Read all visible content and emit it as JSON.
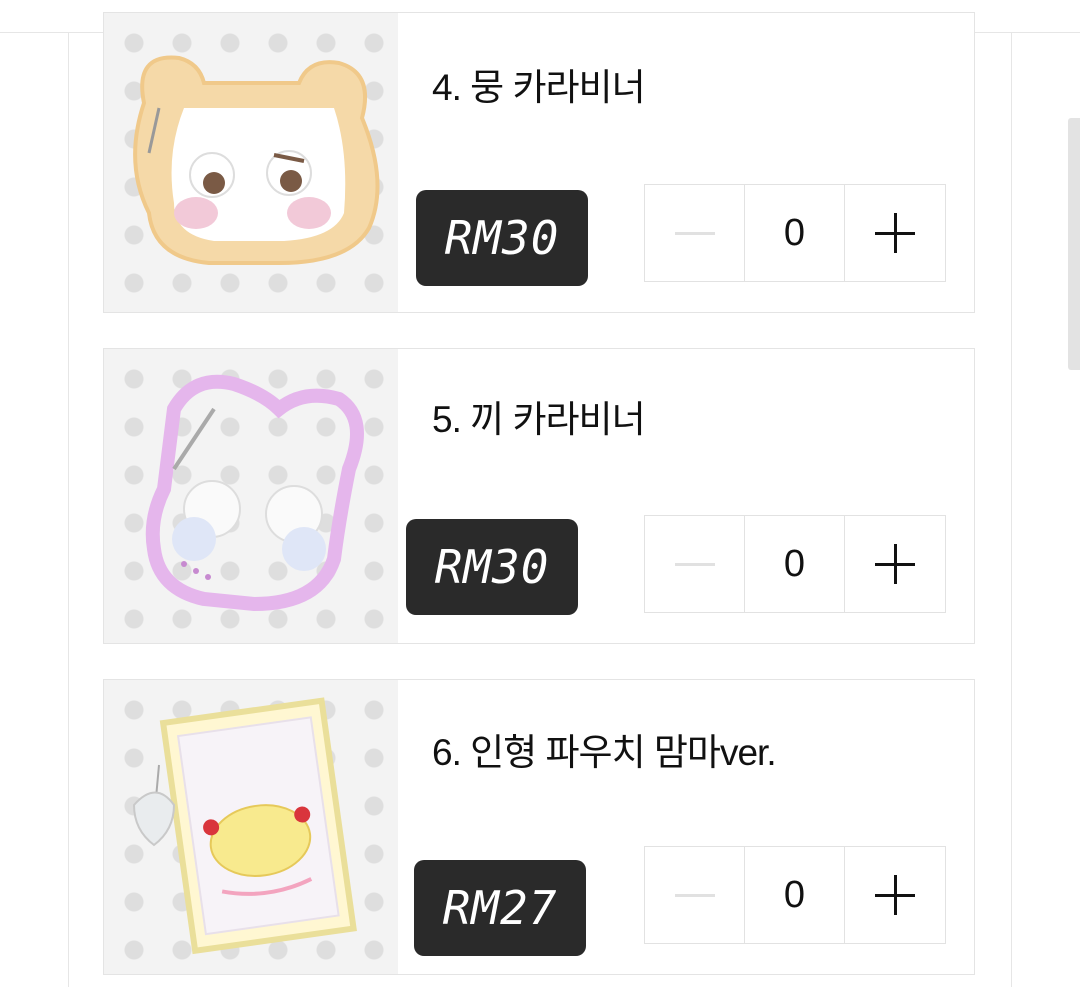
{
  "products": [
    {
      "title": "4. 뭉 카라비너",
      "price": "RM30",
      "quantity": "0"
    },
    {
      "title": "5. 끼 카라비너",
      "price": "RM30",
      "quantity": "0"
    },
    {
      "title": "6. 인형 파우치 맘마ver.",
      "price": "RM27",
      "quantity": "0"
    }
  ],
  "icons": {
    "decrease": "minus-icon",
    "increase": "plus-icon"
  },
  "colors": {
    "price_bg": "#2a2a2a",
    "border": "#e4e4e4",
    "disabled": "#e1e1e1"
  }
}
